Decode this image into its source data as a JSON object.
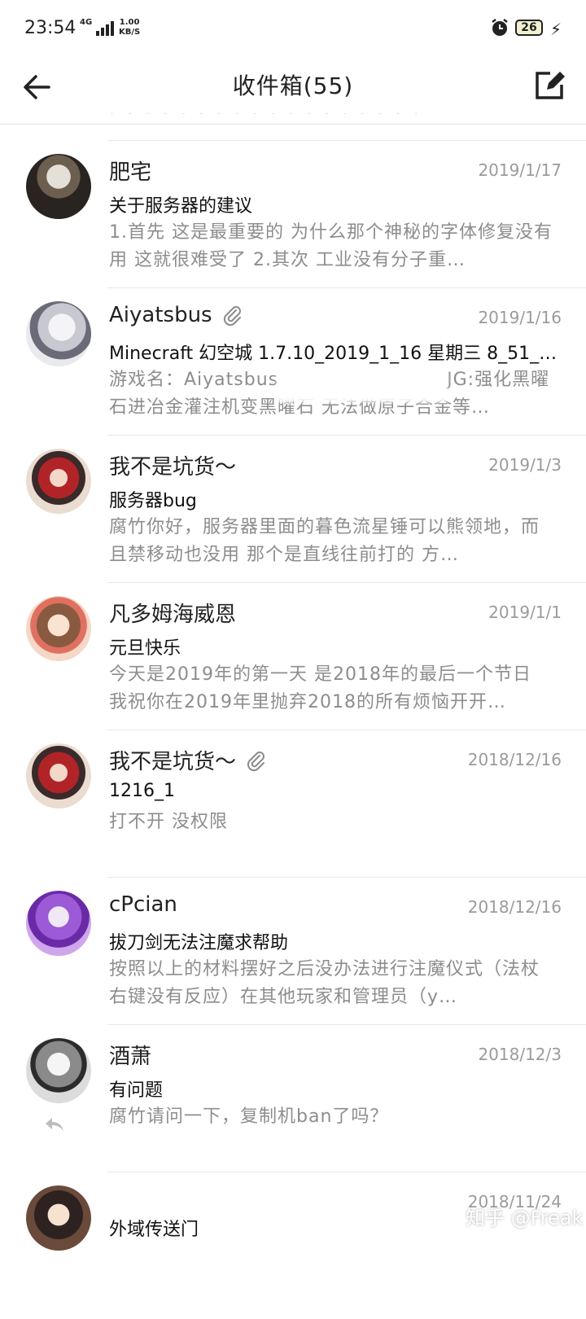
{
  "statusbar": {
    "time": "23:54",
    "network": "4G",
    "speed_value": "1.00",
    "speed_unit": "KB/S",
    "battery": "26"
  },
  "header": {
    "title": "收件箱(55)",
    "back_icon": "arrow-left-icon",
    "compose_icon": "compose-edit-icon"
  },
  "cut_row_text": "· · · · · · · · · · · · · · · · · ·",
  "messages": [
    {
      "sender": "肥宅",
      "date": "2019/1/17",
      "subject": "关于服务器的建议",
      "preview": "1.首先 这是最重要的 为什么那个神秘的字体修复没有用 这就很难受了 2.其次 工业没有分子重…",
      "has_attachment": false
    },
    {
      "sender": "Aiyatsbus",
      "date": "2019/1/16",
      "subject": "Minecraft 幻空城 1.7.10_2019_1_16 星期三 8_51_…",
      "preview": "游戏名：Aiyatsbus　　　　　　　　　JG:强化黑曜石进冶金灌注机变黑曜石 无法做原子合金等…",
      "has_attachment": true
    },
    {
      "sender": "我不是坑货～",
      "date": "2019/1/3",
      "subject": "服务器bug",
      "preview": "腐竹你好，服务器里面的暮色流星锤可以熊领地，而且禁移动也没用 那个是直线往前打的 方…",
      "has_attachment": false
    },
    {
      "sender": "凡多姆海威恩",
      "date": "2019/1/1",
      "subject": "元旦快乐",
      "preview": "今天是2019年的第一天 是2018年的最后一个节日 我祝你在2019年里抛弃2018的所有烦恼开开…",
      "has_attachment": false
    },
    {
      "sender": "我不是坑货～",
      "date": "2018/12/16",
      "subject": "1216_1",
      "preview": "打不开 没权限",
      "has_attachment": true
    },
    {
      "sender": "cPcian",
      "date": "2018/12/16",
      "subject": "拔刀剑无法注魔求帮助",
      "preview": "按照以上的材料摆好之后没办法进行注魔仪式（法杖右键没有反应）在其他玩家和管理员（y…",
      "has_attachment": false
    },
    {
      "sender": "酒萧",
      "date": "2018/12/3",
      "subject": "有问题",
      "preview": "腐竹请问一下，复制机ban了吗？",
      "has_attachment": false,
      "replied": true
    },
    {
      "sender": "",
      "date": "2018/11/24",
      "subject": "外域传送门",
      "preview": "",
      "has_attachment": false
    }
  ],
  "watermark": "知乎 @Freak"
}
